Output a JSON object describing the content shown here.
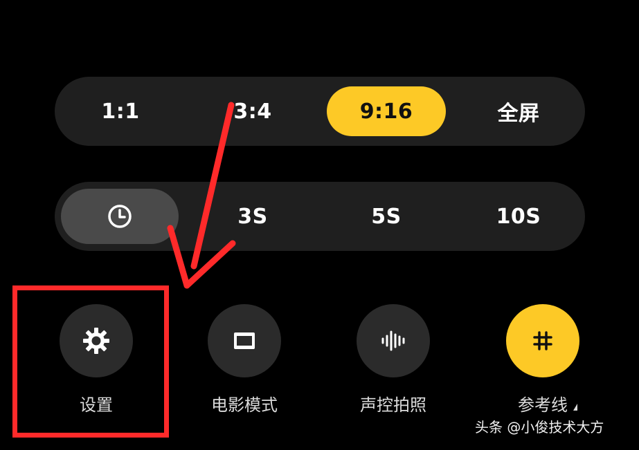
{
  "ratio_options": [
    {
      "label": "1:1",
      "selected": false
    },
    {
      "label": "3:4",
      "selected": false
    },
    {
      "label": "9:16",
      "selected": true
    },
    {
      "label": "全屏",
      "selected": false
    }
  ],
  "timer_options": [
    {
      "label": "",
      "icon": "clock-icon",
      "selected": true
    },
    {
      "label": "3S",
      "selected": false
    },
    {
      "label": "5S",
      "selected": false
    },
    {
      "label": "10S",
      "selected": false
    }
  ],
  "quick_actions": [
    {
      "label": "设置",
      "icon": "gear-icon",
      "active": false
    },
    {
      "label": "电影模式",
      "icon": "movie-frame-icon",
      "active": false
    },
    {
      "label": "声控拍照",
      "icon": "sound-wave-icon",
      "active": false
    },
    {
      "label": "参考线",
      "icon": "grid-hash-icon",
      "active": true
    }
  ],
  "watermark": "头条 @小俊技术大方",
  "colors": {
    "accent_yellow": "#fdc926",
    "annotation_red": "#ff2a2a",
    "bar_bg": "#1f1f1f",
    "button_bg": "#2b2b2b"
  }
}
